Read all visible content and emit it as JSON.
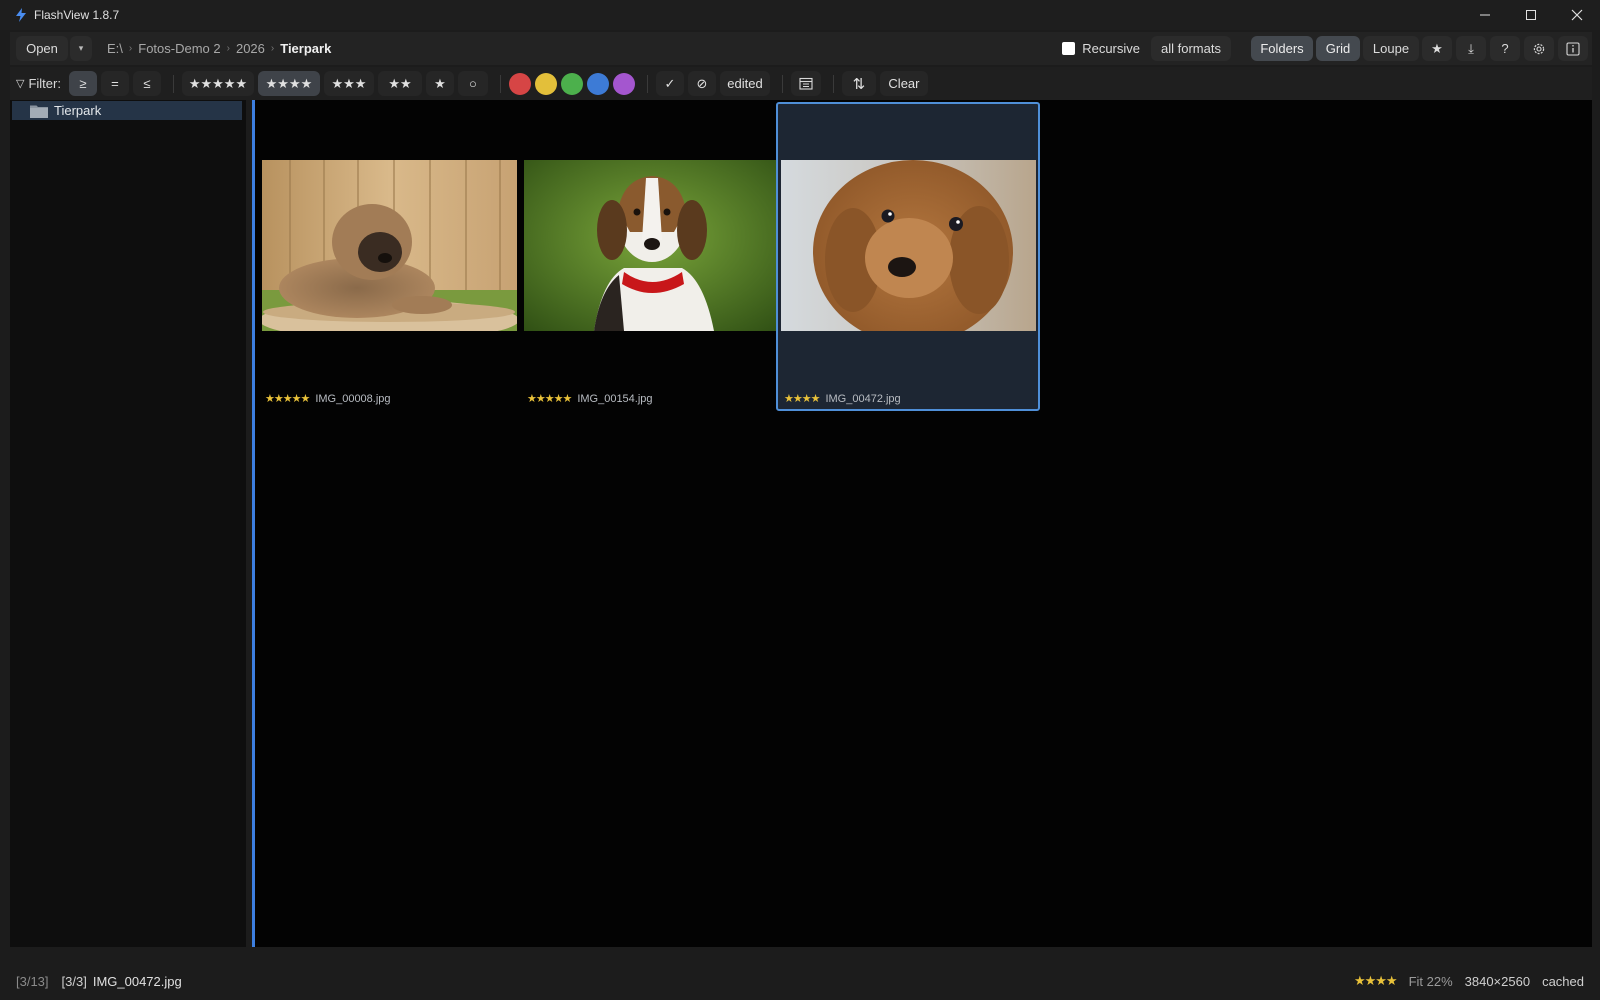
{
  "window": {
    "title": "FlashView 1.8.7",
    "controls": [
      "minimize",
      "maximize",
      "close"
    ]
  },
  "toolbar": {
    "open_label": "Open",
    "dropdown_glyph": "▾",
    "breadcrumb": [
      "E:\\",
      "Fotos-Demo 2",
      "2026",
      "Tierpark"
    ],
    "breadcrumb_separator": "›",
    "recursive_label": "Recursive",
    "recursive_checked": false,
    "formats_label": "all formats",
    "folders_label": "Folders",
    "grid_label": "Grid",
    "loupe_label": "Loupe",
    "star_glyph": "★",
    "download_glyph": "⤓",
    "help_glyph": "?",
    "active_view": "Grid"
  },
  "filter": {
    "label": "Filter:",
    "funnel_glyph": "▽",
    "comparators": [
      "≥",
      "=",
      "≤"
    ],
    "active_comparator": "≥",
    "ratings": [
      "★★★★★",
      "★★★★",
      "★★★",
      "★★",
      "★",
      "○"
    ],
    "active_rating": "★★★★",
    "colors": [
      "#d64545",
      "#e3bf3a",
      "#4cb04c",
      "#3d7bd6",
      "#a456cf"
    ],
    "flag_glyph": "✓",
    "reject_glyph": "⊘",
    "edited_label": "edited",
    "sort_glyph": "⇅",
    "clear_label": "Clear"
  },
  "sidebar": {
    "folders": [
      {
        "label": "Tierpark",
        "selected": true
      }
    ]
  },
  "grid": {
    "items": [
      {
        "stars": "★★★★★",
        "filename": "IMG_00008.jpg",
        "subject": "fluffy brown puppy lying on a tree stump in front of a wooden fence",
        "selected": false
      },
      {
        "stars": "★★★★★",
        "filename": "IMG_00154.jpg",
        "subject": "beagle with red collar on green background",
        "selected": false
      },
      {
        "stars": "★★★★",
        "filename": "IMG_00472.jpg",
        "subject": "curly red-brown puppy close-up",
        "selected": true
      }
    ]
  },
  "status": {
    "count": "[3/13]",
    "index": "[3/3]",
    "filename": "IMG_00472.jpg",
    "stars": "★★★★",
    "zoom": "Fit 22%",
    "dimensions": "3840×2560",
    "cache": "cached"
  },
  "colors": {
    "accent": "#3d7fe0",
    "selection_border": "#4f8fd8",
    "star": "#e9c23a",
    "background": "#030303"
  }
}
